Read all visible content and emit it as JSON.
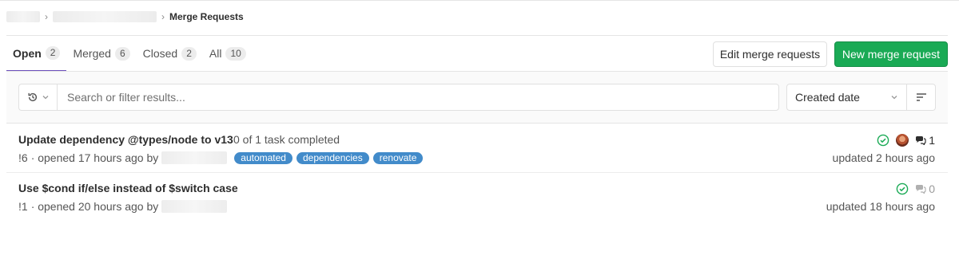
{
  "breadcrumb": {
    "separator": "›",
    "current": "Merge Requests"
  },
  "tabs": [
    {
      "label": "Open",
      "count": "2",
      "active": true
    },
    {
      "label": "Merged",
      "count": "6"
    },
    {
      "label": "Closed",
      "count": "2"
    },
    {
      "label": "All",
      "count": "10"
    }
  ],
  "actions": {
    "edit_label": "Edit merge requests",
    "new_label": "New merge request",
    "new_color": "#1aaa55"
  },
  "filter": {
    "search_placeholder": "Search or filter results...",
    "sort_label": "Created date"
  },
  "merge_requests": [
    {
      "title": "Update dependency @types/node to v13",
      "tasks": "0 of 1 task completed",
      "ref": "!6",
      "opened": "· opened 17 hours ago by",
      "labels": [
        "automated",
        "dependencies",
        "renovate"
      ],
      "comments": "1",
      "updated": "updated 2 hours ago"
    },
    {
      "title": "Use $cond if/else instead of $switch case",
      "ref": "!1",
      "opened": "· opened 20 hours ago by",
      "comments": "0",
      "updated": "updated 18 hours ago"
    }
  ],
  "colors": {
    "accent": "#6b4fbb",
    "label": "#428bca",
    "pipeline_success": "#1aaa55"
  },
  "icons": [
    "history-icon",
    "chevron-down-icon",
    "sort-lines-icon",
    "pipeline-success-icon",
    "comment-icon",
    "avatar"
  ]
}
